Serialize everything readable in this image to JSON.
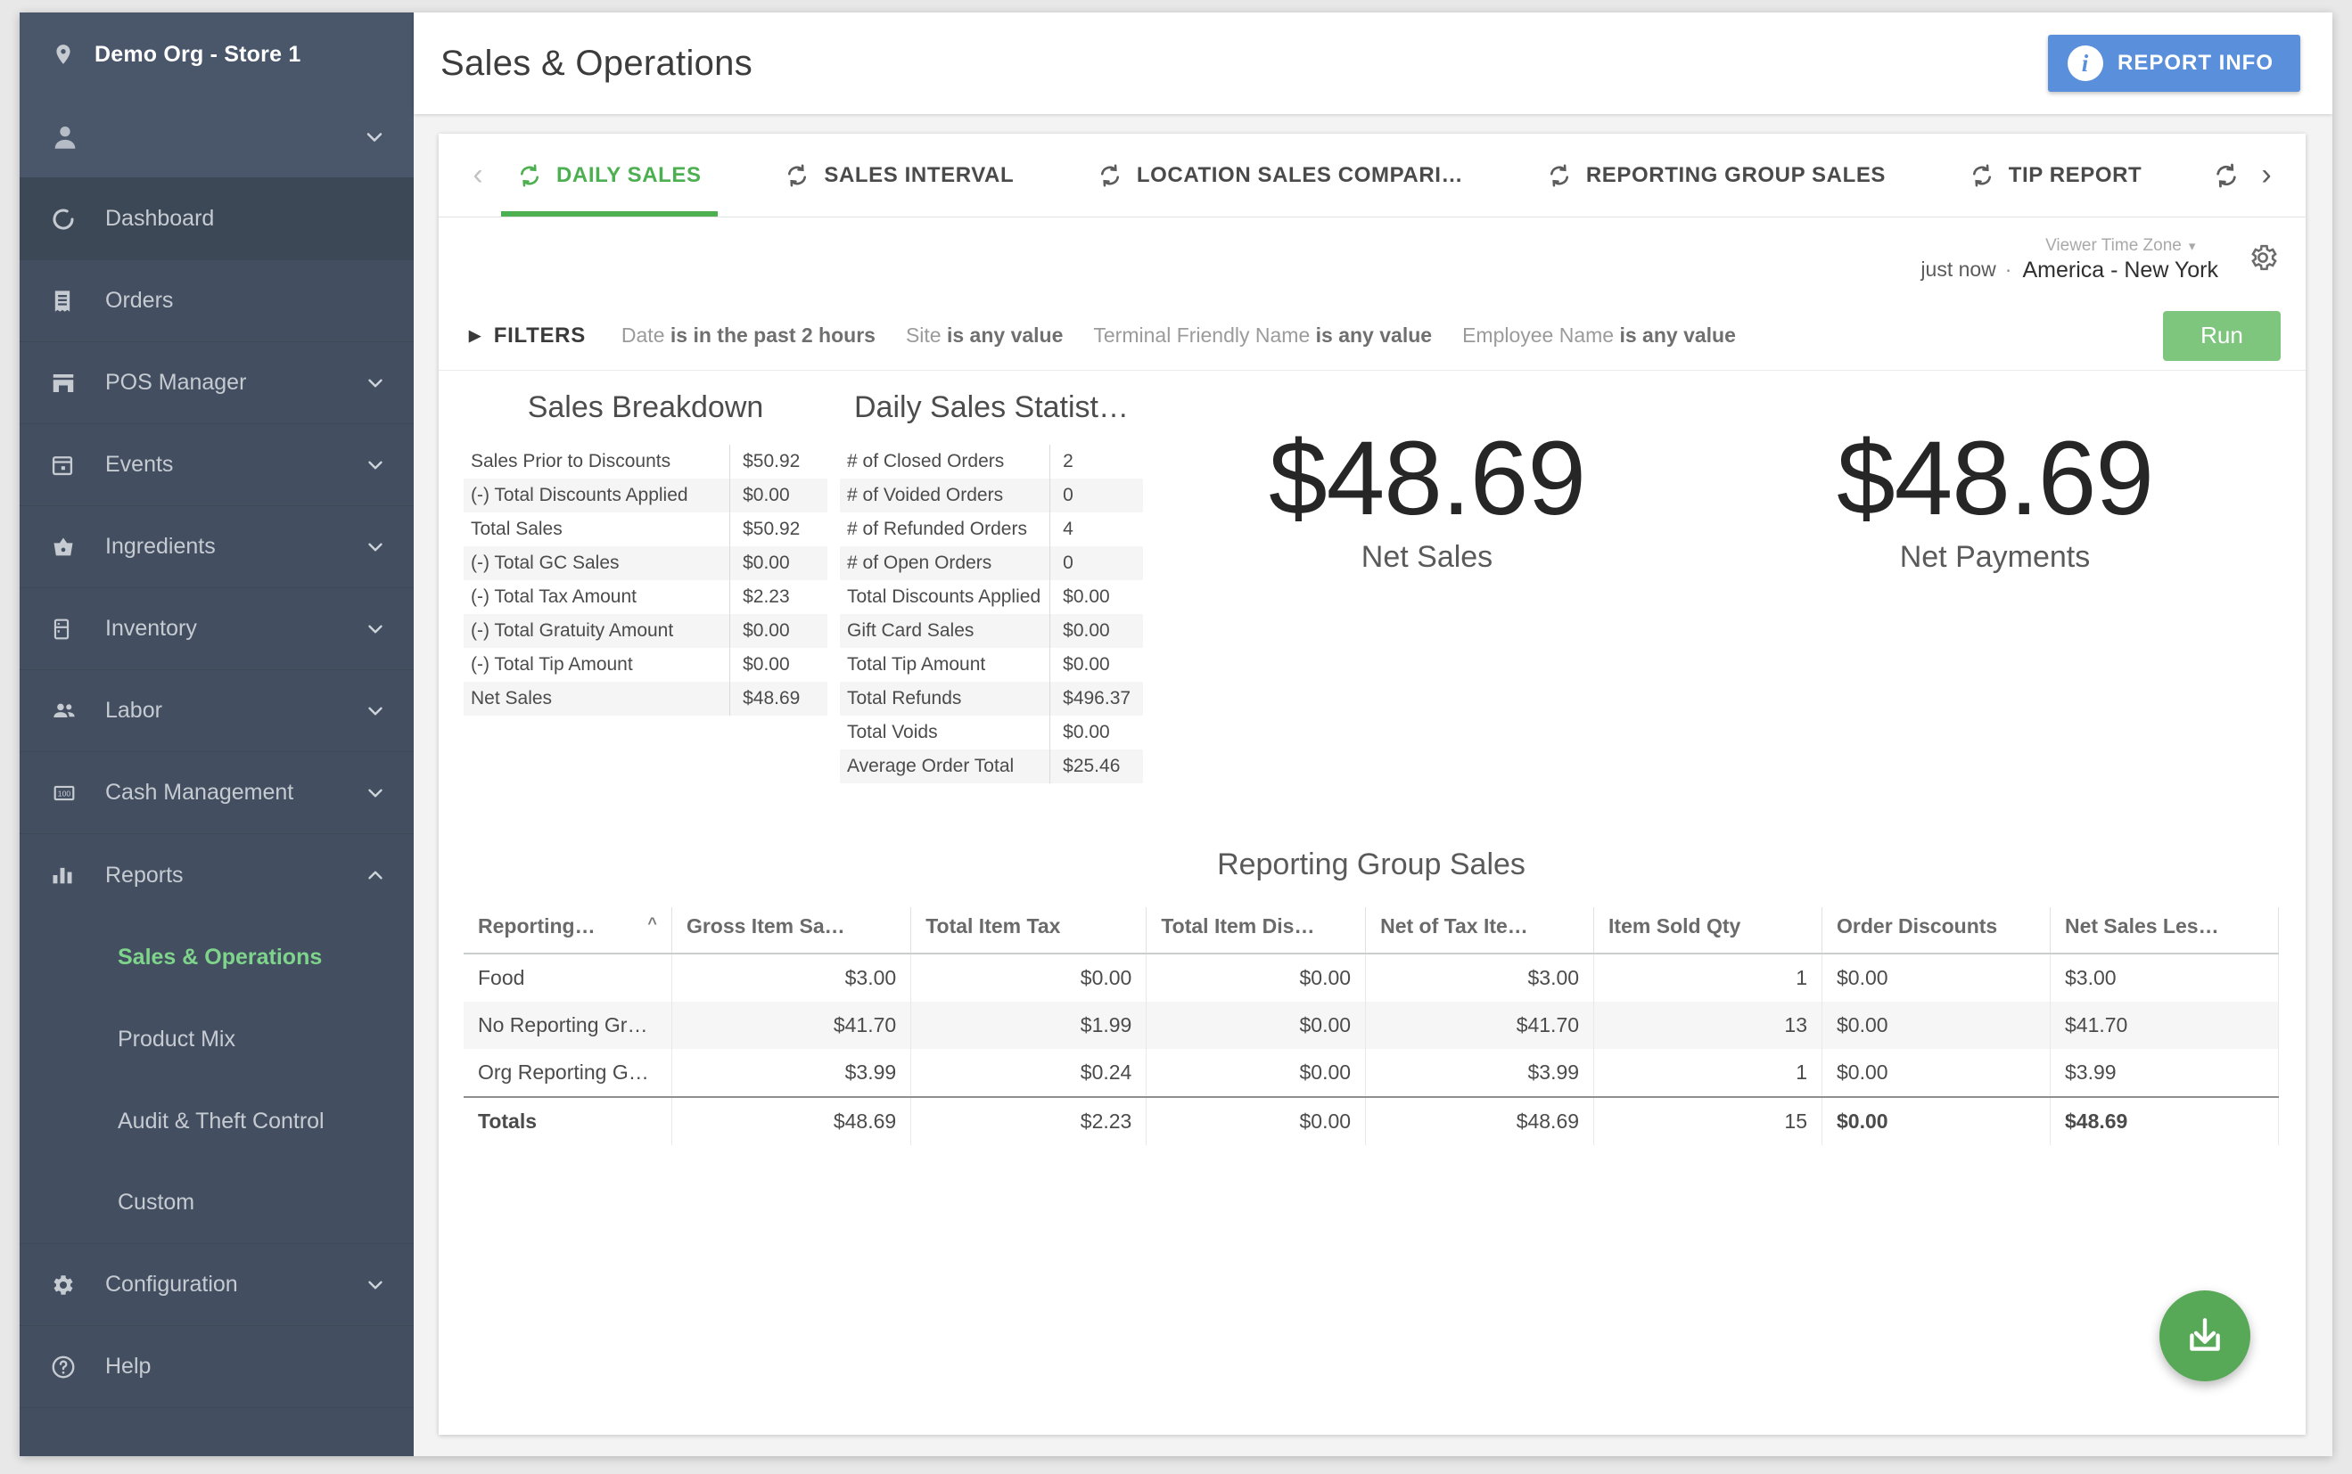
{
  "sidebar": {
    "org": {
      "name": "Demo Org - Store 1",
      "icon": "location-pin-icon"
    },
    "user": {
      "icon": "person-icon",
      "chevron": "chevron-down-icon"
    },
    "items": [
      {
        "label": "Dashboard",
        "icon": "dashboard-icon",
        "expandable": false
      },
      {
        "label": "Orders",
        "icon": "receipt-icon",
        "expandable": false
      },
      {
        "label": "POS Manager",
        "icon": "store-icon",
        "expandable": true
      },
      {
        "label": "Events",
        "icon": "calendar-icon",
        "expandable": true
      },
      {
        "label": "Ingredients",
        "icon": "basket-icon",
        "expandable": true
      },
      {
        "label": "Inventory",
        "icon": "fridge-icon",
        "expandable": true
      },
      {
        "label": "Labor",
        "icon": "people-icon",
        "expandable": true
      },
      {
        "label": "Cash Management",
        "icon": "cash-icon",
        "expandable": true
      },
      {
        "label": "Reports",
        "icon": "bar-chart-icon",
        "expandable": true,
        "expanded": true
      }
    ],
    "reports_children": [
      {
        "label": "Sales & Operations",
        "selected": true
      },
      {
        "label": "Product Mix",
        "selected": false
      },
      {
        "label": "Audit & Theft Control",
        "selected": false
      },
      {
        "label": "Custom",
        "selected": false
      }
    ],
    "items_after": [
      {
        "label": "Configuration",
        "icon": "gear-icon",
        "expandable": true
      },
      {
        "label": "Help",
        "icon": "help-circle-icon",
        "expandable": false
      }
    ]
  },
  "header": {
    "title": "Sales & Operations",
    "report_info_label": "REPORT INFO",
    "report_info_icon": "info-icon",
    "report_info_color": "#5a8fdb"
  },
  "tabs": {
    "prev_icon": "chevron-left-icon",
    "next_icon": "chevron-right-icon",
    "refresh_icon": "refresh-icon",
    "items": [
      {
        "label": "DAILY SALES",
        "active": true
      },
      {
        "label": "SALES INTERVAL",
        "active": false
      },
      {
        "label": "LOCATION SALES COMPARI…",
        "active": false
      },
      {
        "label": "REPORTING GROUP SALES",
        "active": false
      },
      {
        "label": "TIP REPORT",
        "active": false
      }
    ],
    "active_color": "#4caf50"
  },
  "meta": {
    "refreshed": "just now",
    "separator": "·",
    "timezone_label": "Viewer Time Zone",
    "timezone_value": "America - New York",
    "gear_icon": "gear-icon",
    "chevron_icon": "chevron-down-icon"
  },
  "filters": {
    "toggle_label": "FILTERS",
    "caret_icon": "caret-right-icon",
    "chips": [
      {
        "field": "Date",
        "value": "is in the past 2 hours"
      },
      {
        "field": "Site",
        "value": "is any value"
      },
      {
        "field": "Terminal Friendly Name",
        "value": "is any value"
      },
      {
        "field": "Employee Name",
        "value": "is any value"
      }
    ],
    "run_label": "Run",
    "run_color": "#7ec67e"
  },
  "sales_breakdown": {
    "title": "Sales Breakdown",
    "rows": [
      {
        "label": "Sales Prior to Discounts",
        "value": "$50.92"
      },
      {
        "label": "(-) Total Discounts Applied",
        "value": "$0.00"
      },
      {
        "label": "Total Sales",
        "value": "$50.92"
      },
      {
        "label": "(-) Total GC Sales",
        "value": "$0.00"
      },
      {
        "label": "(-) Total Tax Amount",
        "value": "$2.23"
      },
      {
        "label": "(-) Total Gratuity Amount",
        "value": "$0.00"
      },
      {
        "label": "(-) Total Tip Amount",
        "value": "$0.00"
      },
      {
        "label": "Net Sales",
        "value": "$48.69"
      }
    ]
  },
  "daily_sales_statistics": {
    "title": "Daily Sales Statist…",
    "rows": [
      {
        "label": "# of Closed Orders",
        "value": "2"
      },
      {
        "label": "# of Voided Orders",
        "value": "0"
      },
      {
        "label": "# of Refunded Orders",
        "value": "4"
      },
      {
        "label": "# of Open Orders",
        "value": "0"
      },
      {
        "label": "Total Discounts Applied",
        "value": "$0.00"
      },
      {
        "label": "Gift Card Sales",
        "value": "$0.00"
      },
      {
        "label": "Total Tip Amount",
        "value": "$0.00"
      },
      {
        "label": "Total Refunds",
        "value": "$496.37"
      },
      {
        "label": "Total Voids",
        "value": "$0.00"
      },
      {
        "label": "Average Order Total",
        "value": "$25.46"
      }
    ]
  },
  "kpis": [
    {
      "value": "$48.69",
      "label": "Net Sales"
    },
    {
      "value": "$48.69",
      "label": "Net Payments"
    }
  ],
  "reporting_group_sales": {
    "title": "Reporting Group Sales",
    "sort_icon": "sort-asc-icon",
    "columns": [
      "Reporting…",
      "Gross Item Sa…",
      "Total Item Tax",
      "Total Item Dis…",
      "Net of Tax Ite…",
      "Item Sold Qty",
      "Order Discounts",
      "Net Sales Les…"
    ],
    "rows": [
      [
        "Food",
        "$3.00",
        "$0.00",
        "$0.00",
        "$3.00",
        "1",
        "$0.00",
        "$3.00"
      ],
      [
        "No Reporting Gr…",
        "$41.70",
        "$1.99",
        "$0.00",
        "$41.70",
        "13",
        "$0.00",
        "$41.70"
      ],
      [
        "Org Reporting G…",
        "$3.99",
        "$0.24",
        "$0.00",
        "$3.99",
        "1",
        "$0.00",
        "$3.99"
      ]
    ],
    "totals": [
      "Totals",
      "$48.69",
      "$2.23",
      "$0.00",
      "$48.69",
      "15",
      "$0.00",
      "$48.69"
    ]
  },
  "download_fab": {
    "icon": "download-icon",
    "color": "#57a857"
  }
}
